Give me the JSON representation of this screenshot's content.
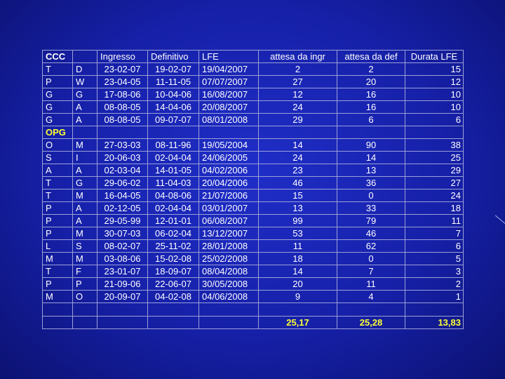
{
  "columns": [
    "CCC",
    "",
    "Ingresso",
    "Definitivo",
    "LFE",
    "attesa da ingr",
    "attesa da def",
    "Durata LFE"
  ],
  "rows_ccc": [
    [
      "T",
      "D",
      "23-02-07",
      "19-02-07",
      "19/04/2007",
      "2",
      "2",
      "15"
    ],
    [
      "P",
      "W",
      "23-04-05",
      "11-11-05",
      "07/07/2007",
      "27",
      "20",
      "12"
    ],
    [
      "G",
      "G",
      "17-08-06",
      "10-04-06",
      "16/08/2007",
      "12",
      "16",
      "10"
    ],
    [
      "G",
      "A",
      "08-08-05",
      "14-04-06",
      "20/08/2007",
      "24",
      "16",
      "10"
    ],
    [
      "G",
      "A",
      "08-08-05",
      "09-07-07",
      "08/01/2008",
      "29",
      "6",
      "6"
    ]
  ],
  "group_label": "OPG",
  "rows_opg": [
    [
      "O",
      "M",
      "27-03-03",
      "08-11-96",
      "19/05/2004",
      "14",
      "90",
      "38"
    ],
    [
      "S",
      "I",
      "20-06-03",
      "02-04-04",
      "24/06/2005",
      "24",
      "14",
      "25"
    ],
    [
      "A",
      "A",
      "02-03-04",
      "14-01-05",
      "04/02/2006",
      "23",
      "13",
      "29"
    ],
    [
      "T",
      "G",
      "29-06-02",
      "11-04-03",
      "20/04/2006",
      "46",
      "36",
      "27"
    ],
    [
      "T",
      "M",
      "16-04-05",
      "04-08-06",
      "21/07/2006",
      "15",
      "0",
      "24"
    ],
    [
      "P",
      "A",
      "02-12-05",
      "02-04-04",
      "03/01/2007",
      "13",
      "33",
      "18"
    ],
    [
      "P",
      "A",
      "29-05-99",
      "12-01-01",
      "06/08/2007",
      "99",
      "79",
      "11"
    ],
    [
      "P",
      "M",
      "30-07-03",
      "06-02-04",
      "13/12/2007",
      "53",
      "46",
      "7"
    ],
    [
      "L",
      "S",
      "08-02-07",
      "25-11-02",
      "28/01/2008",
      "11",
      "62",
      "6"
    ],
    [
      "M",
      "M",
      "03-08-06",
      "15-02-08",
      "25/02/2008",
      "18",
      "0",
      "5"
    ],
    [
      "T",
      "F",
      "23-01-07",
      "18-09-07",
      "08/04/2008",
      "14",
      "7",
      "3"
    ],
    [
      "P",
      "P",
      "21-09-06",
      "22-06-07",
      "30/05/2008",
      "20",
      "11",
      "2"
    ],
    [
      "M",
      "O",
      "20-09-07",
      "04-02-08",
      "04/06/2008",
      "9",
      "4",
      "1"
    ]
  ],
  "totals": {
    "attesa_ingr": "25,17",
    "attesa_def": "25,28",
    "durata": "13,83"
  },
  "colors": {
    "background": "#1620a8",
    "text": "#ffffff",
    "highlight": "#ffff33"
  }
}
